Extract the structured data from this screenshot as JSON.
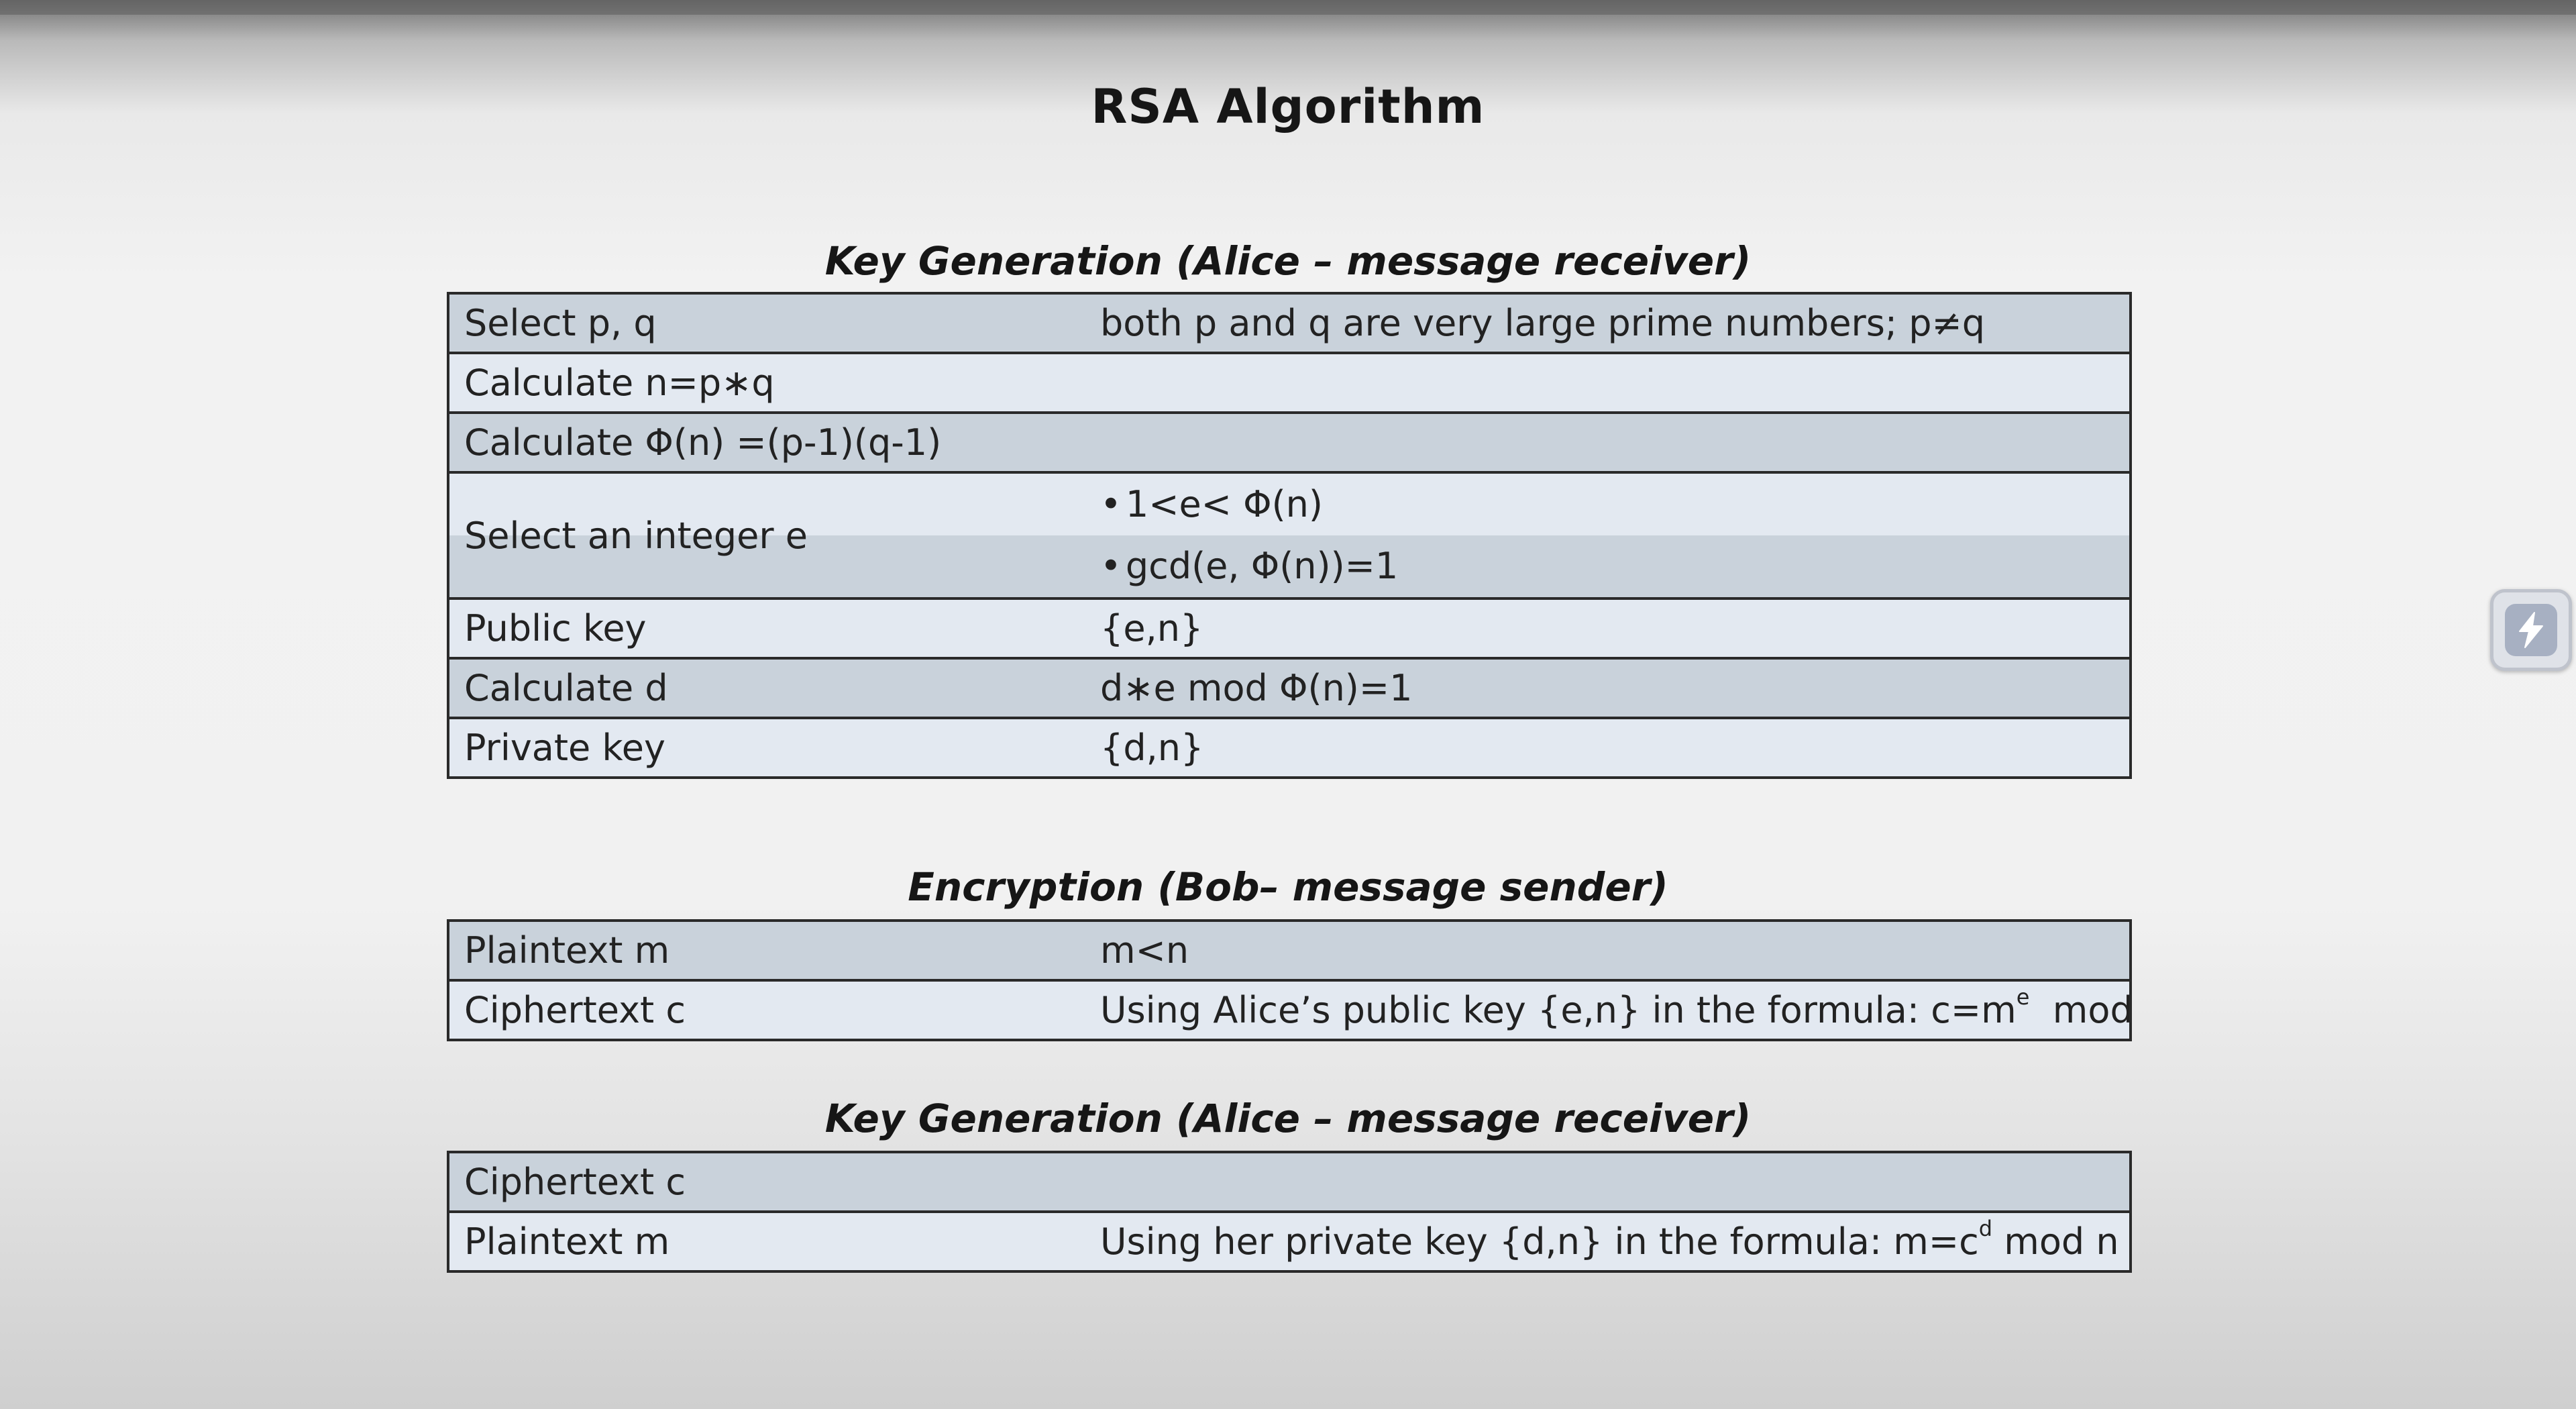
{
  "title": "RSA Algorithm",
  "key_generation": {
    "heading": "Key Generation (Alice – message receiver)",
    "rows": [
      {
        "label": "Select p, q",
        "value": "both p and q are very large prime numbers; p≠q"
      },
      {
        "label": "Calculate n=p∗q",
        "value": ""
      },
      {
        "label": "Calculate Φ(n) =(p-1)(q-1)",
        "value": ""
      },
      {
        "label": "Select an integer  e",
        "bullets": [
          "1<e< Φ(n)",
          "gcd(e, Φ(n))=1"
        ]
      },
      {
        "label": "Public key",
        "value": "{e,n}"
      },
      {
        "label": "Calculate d",
        "value": "d∗e mod Φ(n)=1"
      },
      {
        "label": "Private key",
        "value": "{d,n}"
      }
    ]
  },
  "encryption": {
    "heading": "Encryption (Bob– message sender)",
    "rows": [
      {
        "label": "Plaintext m",
        "value": "m<n"
      },
      {
        "label": "Ciphertext c",
        "value_prefix": "Using Alice’s public key {e,n} in the formula: c=m",
        "value_sup": "e",
        "value_suffix": "  mod n"
      }
    ]
  },
  "decryption": {
    "heading": "Key Generation (Alice – message receiver)",
    "rows": [
      {
        "label": "Ciphertext c",
        "value": ""
      },
      {
        "label": "Plaintext m",
        "value_prefix": "Using her private key {d,n} in the formula: m=c",
        "value_sup": "d",
        "value_suffix": " mod n"
      }
    ]
  },
  "bullet_symbol": "•",
  "side_widget_icon": "lightning-bolt-icon"
}
